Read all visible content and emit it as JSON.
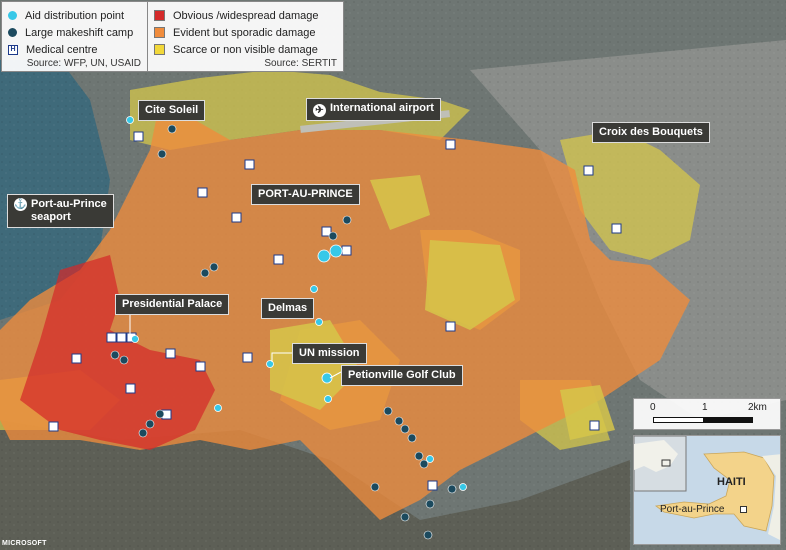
{
  "legend_left": {
    "items": [
      {
        "label": "Aid distribution point",
        "symbol": "aid-dot",
        "color": "#37c8e8"
      },
      {
        "label": "Large makeshift camp",
        "symbol": "camp-dot",
        "color": "#1c4a5e"
      },
      {
        "label": "Medical centre",
        "symbol": "medical-icon",
        "color": "#1e3a8a"
      }
    ],
    "source": "Source: WFP, UN, USAID"
  },
  "legend_right": {
    "items": [
      {
        "label": "Obvious /widespread damage",
        "color": "#d42a2a"
      },
      {
        "label": "Evident but sporadic damage",
        "color": "#f08c3c"
      },
      {
        "label": "Scarce or non visible damage",
        "color": "#f2d83a"
      }
    ],
    "source": "Source: SERTIT"
  },
  "places": {
    "cite_soleil": "Cite Soleil",
    "airport": "International airport",
    "port_au_prince": "PORT-AU-PRINCE",
    "croix": "Croix des Bouquets",
    "seaport": "Port-au-Prince\nseaport",
    "palace": "Presidential Palace",
    "delmas": "Delmas",
    "un_mission": "UN mission",
    "petionville": "Petionville Golf Club"
  },
  "scale": {
    "ticks": [
      "0",
      "1",
      "2km"
    ]
  },
  "inset": {
    "country": "HAITI",
    "city": "Port-au-Prince"
  },
  "credit": "MICROSOFT"
}
